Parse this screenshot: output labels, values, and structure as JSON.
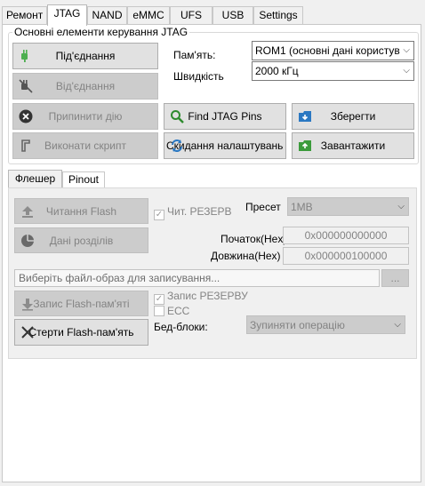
{
  "tabs": [
    "Ремонт",
    "JTAG",
    "NAND",
    "eMMC",
    "UFS",
    "USB",
    "Settings"
  ],
  "active_tab": "JTAG",
  "group_title": "Основні елементи керування JTAG",
  "buttons": {
    "connect": "Під'єднання",
    "disconnect": "Від'єднання",
    "stop": "Припинити дію",
    "run_script": "Виконати скрипт",
    "find_pins": "Find JTAG Pins",
    "reset_settings": "Скидання налаштувань Ш",
    "save": "Зберегти",
    "load": "Завантажити"
  },
  "memory": {
    "label": "Пам'ять:",
    "value": "ROM1 (основні дані користув"
  },
  "speed": {
    "label": "Швидкість",
    "value": "2000 кГц"
  },
  "subtabs": [
    "Флешер",
    "Pinout"
  ],
  "active_subtab": "Флешер",
  "flasher": {
    "read_flash": "Читання Flash",
    "partitions": "Дані розділів",
    "read_backup": "Чит. РЕЗЕРВ",
    "preset_label": "Пресет",
    "preset_value": "1MB",
    "start_label": "Початок(Hex)",
    "start_value": "0x000000000000",
    "length_label": "Довжина(Hex)",
    "length_value": "0x000000100000",
    "file_placeholder": "Виберіть файл-образ для записування...",
    "browse": "...",
    "write_flash": "Запис Flash-пам'яті",
    "erase_flash": "Стерти Flash-пам'ять",
    "write_backup": "Запис РЕЗЕРВУ",
    "ecc": "ECC",
    "bad_blocks_label": "Бед-блоки:",
    "bad_blocks_value": "Зупиняти операцію"
  },
  "colors": {
    "connect_icon": "#4caf50",
    "find_icon": "#2e8b2e",
    "save_icon": "#2b78c2",
    "load_icon": "#3b9b3b",
    "stop_icon": "#333333"
  }
}
